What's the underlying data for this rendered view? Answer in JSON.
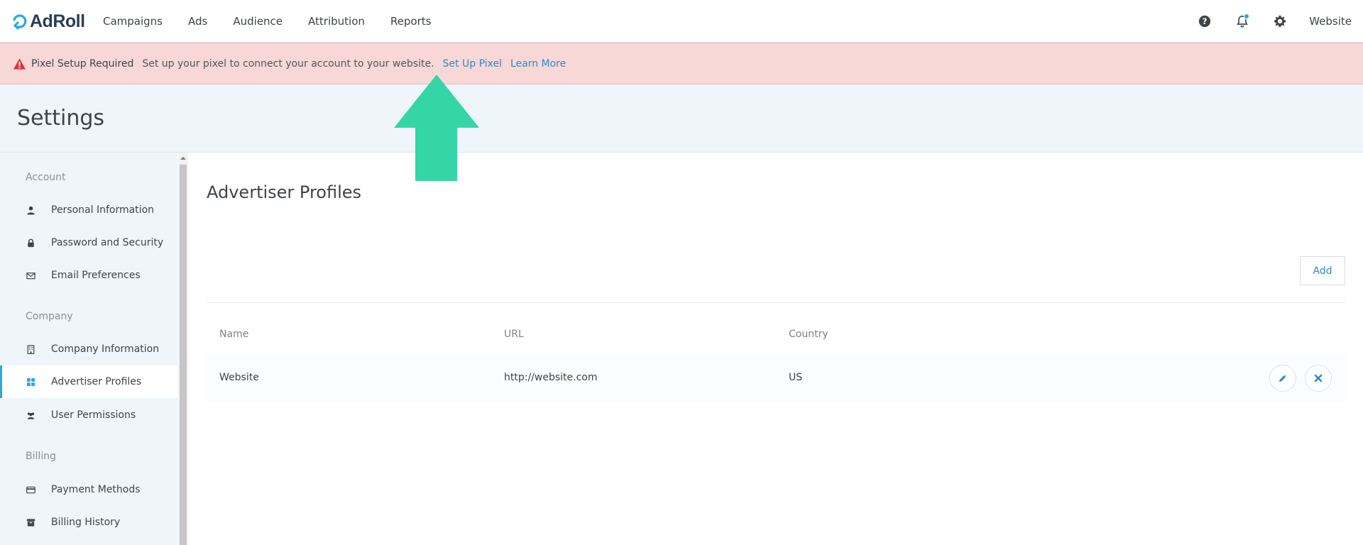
{
  "brand": {
    "name": "AdRoll",
    "accent": "#2ba8e0"
  },
  "nav": {
    "items": [
      "Campaigns",
      "Ads",
      "Audience",
      "Attribution",
      "Reports"
    ],
    "account": "Website",
    "icons": [
      "question-circle-icon",
      "bell-icon",
      "gear-icon"
    ]
  },
  "alert": {
    "title": "Pixel Setup Required",
    "text": "Set up your pixel to connect your account to your website.",
    "link_setup": "Set Up Pixel",
    "link_learn": "Learn More",
    "bg": "#f8d7d7"
  },
  "header": {
    "title": "Settings"
  },
  "sidebar": {
    "sections": [
      {
        "label": "Account",
        "items": [
          {
            "label": "Personal Information",
            "icon": "user-icon"
          },
          {
            "label": "Password and Security",
            "icon": "lock-icon"
          },
          {
            "label": "Email Preferences",
            "icon": "envelope-icon"
          }
        ]
      },
      {
        "label": "Company",
        "items": [
          {
            "label": "Company Information",
            "icon": "building-icon"
          },
          {
            "label": "Advertiser Profiles",
            "icon": "grid-icon",
            "active": true
          },
          {
            "label": "User Permissions",
            "icon": "users-icon"
          }
        ]
      },
      {
        "label": "Billing",
        "items": [
          {
            "label": "Payment Methods",
            "icon": "credit-card-icon"
          },
          {
            "label": "Billing History",
            "icon": "archive-icon"
          }
        ]
      }
    ]
  },
  "main": {
    "title": "Advertiser Profiles",
    "add_label": "Add",
    "columns": [
      "Name",
      "URL",
      "Country"
    ],
    "rows": [
      {
        "name": "Website",
        "url": "http://website.com",
        "country": "US"
      }
    ]
  },
  "annotation": {
    "arrow_color": "#34d6a8"
  }
}
